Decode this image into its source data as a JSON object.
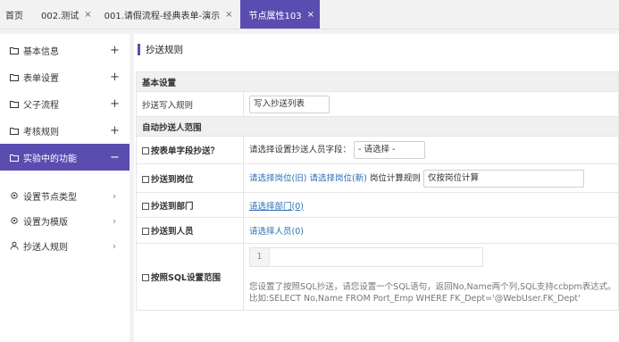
{
  "tabs": [
    {
      "label": "首页",
      "closable": false
    },
    {
      "label": "002.测试",
      "closable": true
    },
    {
      "label": "001.请假流程-经典表单-演示",
      "closable": true
    },
    {
      "label": "节点属性103",
      "closable": true,
      "active": true
    }
  ],
  "tab_close_glyph": "×",
  "sidebar": {
    "groups": [
      {
        "label": "基本信息",
        "expander": "+"
      },
      {
        "label": "表单设置",
        "expander": "+"
      },
      {
        "label": "父子流程",
        "expander": "+"
      },
      {
        "label": "考核规则",
        "expander": "+"
      },
      {
        "label": "实验中的功能",
        "expander": "−",
        "active": true
      }
    ],
    "items": [
      {
        "label": "设置节点类型",
        "expander": "›"
      },
      {
        "label": "设置为模版",
        "expander": "›"
      },
      {
        "label": "抄送人规则",
        "expander": "›"
      }
    ]
  },
  "main": {
    "title": "抄送规则",
    "basic_group": "基本设置",
    "write_rule_label": "抄送写入规则",
    "write_rule_value": "写入抄送列表",
    "auto_group": "自动抄送人范围",
    "by_form_field": {
      "label": "按表单字段抄送？",
      "prompt": "请选择设置抄送人员字段：",
      "select_value": "- 请选择 -"
    },
    "to_station": {
      "label": "抄送到岗位",
      "link_old": "请选择岗位(旧)",
      "link_new": "请选择岗位(新)",
      "calc_label": "岗位计算规则",
      "calc_value": "仅按岗位计算"
    },
    "to_dept": {
      "label": "抄送到部门",
      "link": "请选择部门(0)"
    },
    "to_emp": {
      "label": "抄送到人员",
      "link": "请选择人员(0)"
    },
    "by_sql": {
      "label": "按照SQL设置范围",
      "line_number": "1",
      "note_line1": "您设置了按照SQL抄送，请您设置一个SQL语句，返回No,Name两个列,SQL支持ccbpm表达式。",
      "note_line2": "比如:SELECT No,Name FROM Port_Emp WHERE FK_Dept='@WebUser.FK_Dept'"
    }
  }
}
